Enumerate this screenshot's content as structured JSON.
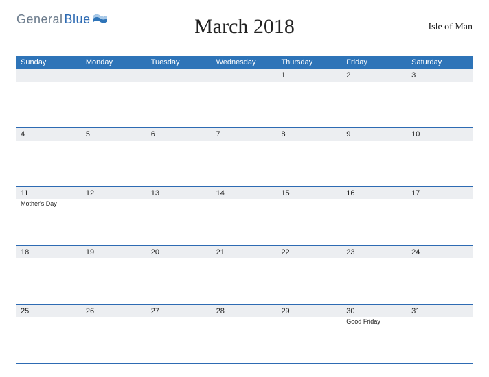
{
  "logo": {
    "text1": "General",
    "text2": "Blue"
  },
  "title": "March 2018",
  "region": "Isle of Man",
  "daysOfWeek": [
    "Sunday",
    "Monday",
    "Tuesday",
    "Wednesday",
    "Thursday",
    "Friday",
    "Saturday"
  ],
  "weeks": [
    [
      {
        "date": "",
        "event": ""
      },
      {
        "date": "",
        "event": ""
      },
      {
        "date": "",
        "event": ""
      },
      {
        "date": "",
        "event": ""
      },
      {
        "date": "1",
        "event": ""
      },
      {
        "date": "2",
        "event": ""
      },
      {
        "date": "3",
        "event": ""
      }
    ],
    [
      {
        "date": "4",
        "event": ""
      },
      {
        "date": "5",
        "event": ""
      },
      {
        "date": "6",
        "event": ""
      },
      {
        "date": "7",
        "event": ""
      },
      {
        "date": "8",
        "event": ""
      },
      {
        "date": "9",
        "event": ""
      },
      {
        "date": "10",
        "event": ""
      }
    ],
    [
      {
        "date": "11",
        "event": "Mother's Day"
      },
      {
        "date": "12",
        "event": ""
      },
      {
        "date": "13",
        "event": ""
      },
      {
        "date": "14",
        "event": ""
      },
      {
        "date": "15",
        "event": ""
      },
      {
        "date": "16",
        "event": ""
      },
      {
        "date": "17",
        "event": ""
      }
    ],
    [
      {
        "date": "18",
        "event": ""
      },
      {
        "date": "19",
        "event": ""
      },
      {
        "date": "20",
        "event": ""
      },
      {
        "date": "21",
        "event": ""
      },
      {
        "date": "22",
        "event": ""
      },
      {
        "date": "23",
        "event": ""
      },
      {
        "date": "24",
        "event": ""
      }
    ],
    [
      {
        "date": "25",
        "event": ""
      },
      {
        "date": "26",
        "event": ""
      },
      {
        "date": "27",
        "event": ""
      },
      {
        "date": "28",
        "event": ""
      },
      {
        "date": "29",
        "event": ""
      },
      {
        "date": "30",
        "event": "Good Friday"
      },
      {
        "date": "31",
        "event": ""
      }
    ]
  ]
}
